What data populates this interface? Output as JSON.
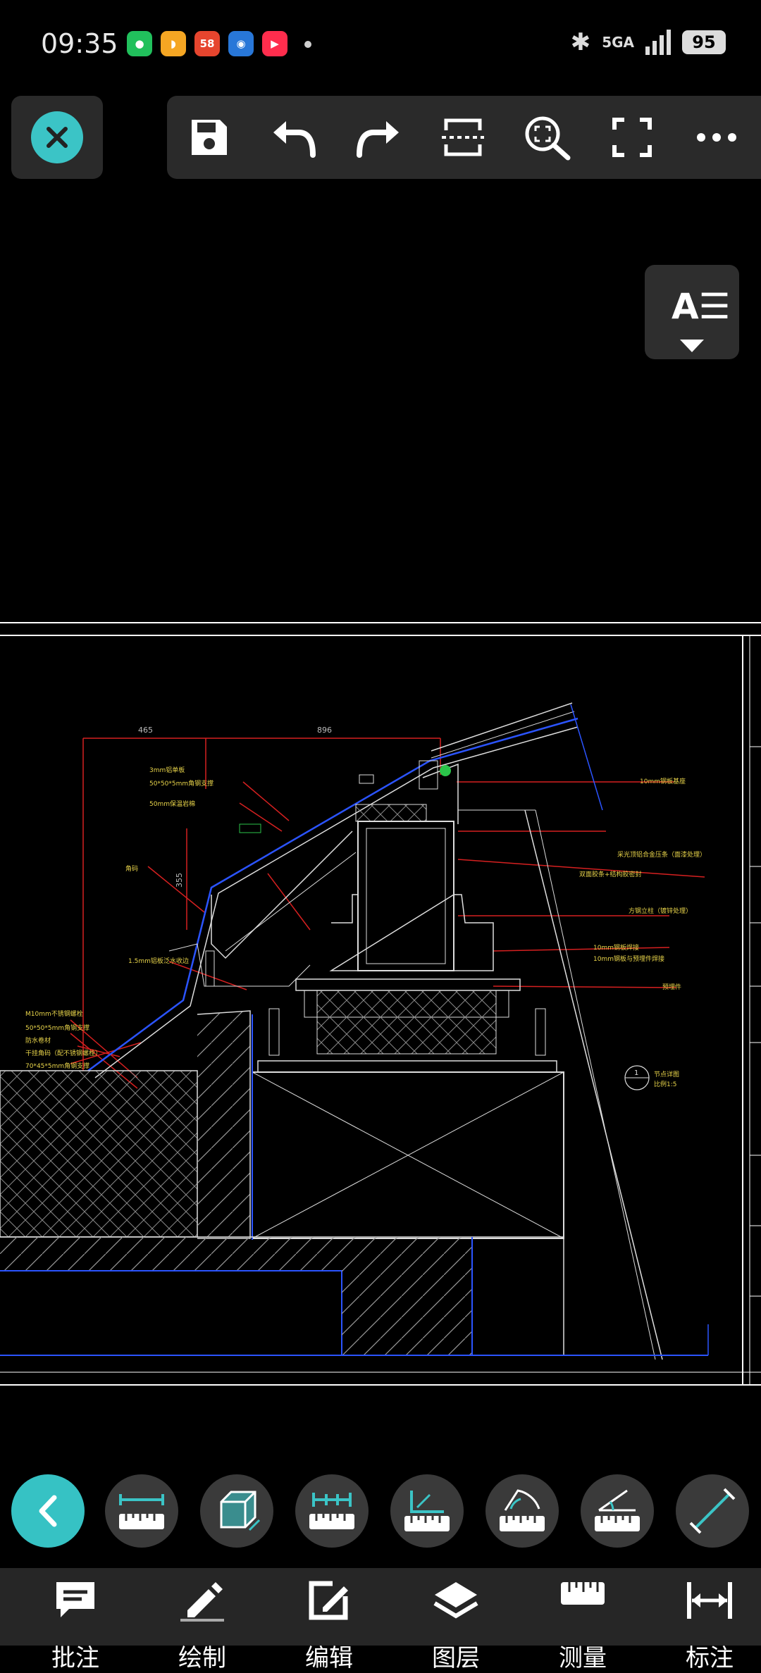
{
  "status": {
    "time": "09:35",
    "apps": [
      {
        "name": "wechat-icon",
        "color": "#21c05c",
        "label": ""
      },
      {
        "name": "didi-icon",
        "color": "#f5a623",
        "label": ""
      },
      {
        "name": "58-icon",
        "color": "#e6452e",
        "label": "58"
      },
      {
        "name": "ctrip-icon",
        "color": "#2877d8",
        "label": ""
      },
      {
        "name": "video-icon",
        "color": "#ff2d4d",
        "label": ""
      }
    ],
    "network": "5GA",
    "battery": "95"
  },
  "toolbar": {
    "close": "close-icon",
    "tools": [
      "save-icon",
      "undo-icon",
      "redo-icon",
      "split-view-icon",
      "zoom-extents-icon",
      "fullscreen-icon",
      "more-icon"
    ]
  },
  "text_style_button": {
    "glyph": "A☰"
  },
  "drawing": {
    "dim_top_left": "465",
    "dim_top_right": "896",
    "dim_vertical": "355",
    "labels": [
      "3mm铝单板",
      "50*50*5mm角钢支撑",
      "50mm保温岩棉",
      "10mm钢板基座",
      "角码",
      "1.5mm铝板泛水收边",
      "M10mm不锈钢螺栓",
      "50*50*5mm角钢支撑",
      "防水卷材",
      "干挂角码（配不锈钢螺栓）",
      "70*45*5mm角钢支撑",
      "采光顶铝合金压条（面漆处理）",
      "双面胶条+结构胶密封",
      "10mm钢板焊接",
      "方钢立柱（镀锌处理）",
      "10mm钢板与预埋件焊接",
      "预埋件",
      "节点详图",
      "比例1:5"
    ],
    "detail_mark": "1"
  },
  "measure_tools": [
    "back-icon",
    "linear-dimension-icon",
    "area-volume-icon",
    "aligned-dimension-icon",
    "coordinate-icon",
    "arc-length-icon",
    "angle-icon",
    "diagonal-measure-icon"
  ],
  "bottom_tabs": [
    {
      "icon": "comment-icon",
      "label": "批注"
    },
    {
      "icon": "pencil-icon",
      "label": "绘制"
    },
    {
      "icon": "edit-icon",
      "label": "编辑"
    },
    {
      "icon": "layers-icon",
      "label": "图层"
    },
    {
      "icon": "ruler-icon",
      "label": "测量"
    },
    {
      "icon": "dimension-icon",
      "label": "标注"
    }
  ],
  "colors": {
    "accent": "#3bc4c6",
    "panel": "#2a2a2a",
    "annotation_red": "#e02020",
    "line_blue": "#2b54ff"
  }
}
